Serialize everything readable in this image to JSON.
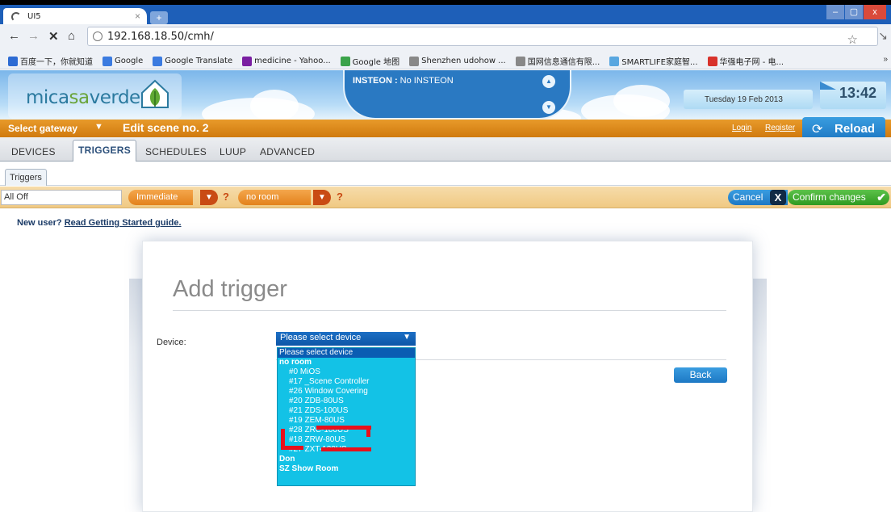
{
  "browser": {
    "tab_title": "UI5",
    "tab_close": "×",
    "new_tab": "+",
    "url": "192.168.18.50/cmh/",
    "win_controls": [
      "–",
      "▢",
      "x"
    ],
    "bookmarks": [
      {
        "label": "百度一下，你就知道",
        "icon_color": "#2d6bd3"
      },
      {
        "label": "Google",
        "icon_color": "#3b7be0"
      },
      {
        "label": "Google Translate",
        "icon_color": "#3b7be0"
      },
      {
        "label": "medicine - Yahoo...",
        "icon_color": "#7a1fa2"
      },
      {
        "label": "Google 地图",
        "icon_color": "#3ba34a"
      },
      {
        "label": "Shenzhen udohow ...",
        "icon_color": "#888888"
      },
      {
        "label": "国网信息通信有限...",
        "icon_color": "#888888"
      },
      {
        "label": "SMARTLIFE家庭智...",
        "icon_color": "#59a7e0"
      },
      {
        "label": "华强电子网 - 电...",
        "icon_color": "#d8322b"
      }
    ],
    "bookmarks_more": "»"
  },
  "header": {
    "logo_part1": "mica",
    "logo_part2": "sa",
    "logo_part3": "verde",
    "insteon_label": "INSTEON :",
    "insteon_value": " No INSTEON",
    "date": "Tuesday 19 Feb 2013",
    "time": "13:42"
  },
  "orange_bar": {
    "gateway": "Select gateway",
    "scene_title": "Edit scene no. 2",
    "login": "Login",
    "register": "Register",
    "reload": "Reload"
  },
  "main_tabs": [
    "DEVICES",
    "TRIGGERS",
    "SCHEDULES",
    "LUUP",
    "ADVANCED"
  ],
  "sub_tab": "Triggers",
  "toolbar": {
    "scene_name": "All Off",
    "mode": "Immediate",
    "room": "no room",
    "qmark": "?",
    "cancel": "Cancel",
    "cancel_x": "X",
    "confirm": "Confirm changes"
  },
  "new_user": {
    "prefix": "New user? ",
    "link": "Read Getting Started guide."
  },
  "dialog": {
    "title": "Add trigger",
    "device_label": "Device:",
    "select_value": "Please select device",
    "back": "Back"
  },
  "dropdown": {
    "items": [
      {
        "text": "Please select device",
        "kind": "selected"
      },
      {
        "text": "no room",
        "kind": "group"
      },
      {
        "text": "#0 MiOS",
        "kind": "item"
      },
      {
        "text": "#17 _Scene Controller",
        "kind": "item"
      },
      {
        "text": "#26 Window Covering",
        "kind": "item"
      },
      {
        "text": "#20 ZDB-80US",
        "kind": "item"
      },
      {
        "text": "#21 ZDS-100US",
        "kind": "item"
      },
      {
        "text": "#19 ZEM-80US",
        "kind": "item"
      },
      {
        "text": "#28 ZRC-100US",
        "kind": "item"
      },
      {
        "text": "#18 ZRW-80US",
        "kind": "item"
      },
      {
        "text": "#27 ZXT-120US",
        "kind": "item"
      },
      {
        "text": "Don",
        "kind": "group"
      },
      {
        "text": "SZ Show Room",
        "kind": "group"
      }
    ]
  },
  "colors": {
    "accent_orange": "#d07a0f",
    "accent_blue": "#1d78c4",
    "dropdown_bg": "#13c2e6",
    "annotation_red": "#e8101c"
  }
}
